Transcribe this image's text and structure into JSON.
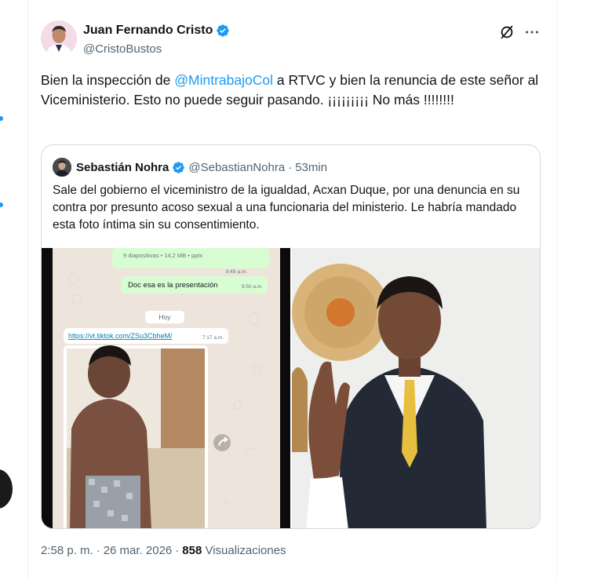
{
  "author": {
    "display_name": "Juan Fernando Cristo",
    "handle": "@CristoBustos",
    "verified_color": "#1d9bf0"
  },
  "tweet": {
    "text_part1": "Bien la inspección de ",
    "mention": "@MintrabajoCol",
    "text_part2": " a RTVC y bien la renuncia de este señor al Viceministerio. Esto no puede seguir pasando.  ¡¡¡¡¡¡¡¡¡ No más !!!!!!!!",
    "time": "2:58 p. m.",
    "date": "26 mar. 2026",
    "views_count": "858",
    "views_label": "Visualizaciones"
  },
  "quote": {
    "display_name": "Sebastián Nohra",
    "handle": "@SebastianNohra",
    "dot": "·",
    "time": "53min",
    "text": "Sale del gobierno el viceministro de la igualdad, Acxan Duque, por una denuncia en su contra por presunto acoso sexual a una funcionaria del ministerio. Le habría mandado esta foto íntima sin su consentimiento."
  },
  "chat_screenshot": {
    "file_info": "9 diapositivas • 14,2 MB • pptx",
    "time1": "9:49 a.m.",
    "message": "Doc esa es la presentación",
    "time2": "9:50 a.m.",
    "day_label": "Hoy",
    "link": "https://vt.tiktok.com/ZSu3CbheM/",
    "time3": "7:17 a.m."
  },
  "icons": [
    "verified-icon",
    "grok-icon",
    "more-icon",
    "share-icon"
  ],
  "colors": {
    "accent": "#1d9bf0",
    "chat_bubble": "#d9fdd3",
    "border": "#cfd9de",
    "muted": "#536471"
  }
}
